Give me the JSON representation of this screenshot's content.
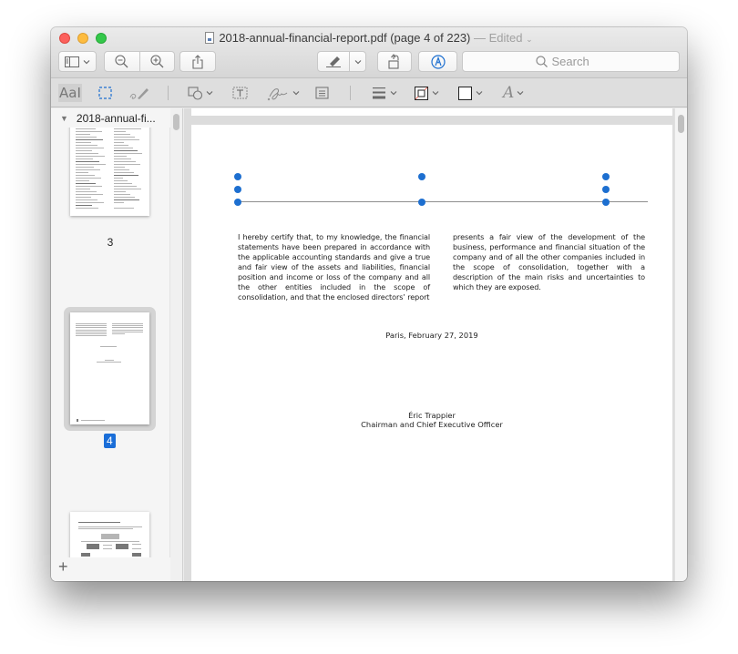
{
  "window": {
    "title": "2018-annual-financial-report.pdf (page 4 of 223)",
    "edited_label": "— Edited",
    "edited_chevron": "⌄"
  },
  "toolbar": {
    "search_placeholder": "Search"
  },
  "sidebar": {
    "document_name": "2018-annual-fi...",
    "pages": [
      {
        "label": "3",
        "selected": false
      },
      {
        "label": "4",
        "selected": true
      },
      {
        "label": "",
        "selected": false
      }
    ],
    "add_label": "+"
  },
  "document": {
    "column_left": "I hereby certify that, to my knowledge, the financial statements have been prepared in accordance with the applicable accounting standards and give a true and fair view of the assets and liabilities, financial position and income or loss of the company and all the other entities included in the scope of consolidation, and that the enclosed directors’ report",
    "column_right": "presents a fair view of the development of the business, performance and financial situation of the company and of all the other companies included in the scope of consolidation, together with a description of the main risks and uncertainties to which they are exposed.",
    "place_date": "Paris, February 27, 2019",
    "signatory_name": "Éric Trappier",
    "signatory_title": "Chairman and Chief Executive Officer"
  },
  "colors": {
    "selection_blue": "#1d6fd0",
    "page_badge": "#1a6ed8",
    "traffic_close": "#fc605c",
    "traffic_minimize": "#fdbc40",
    "traffic_maximize": "#34c84a"
  }
}
